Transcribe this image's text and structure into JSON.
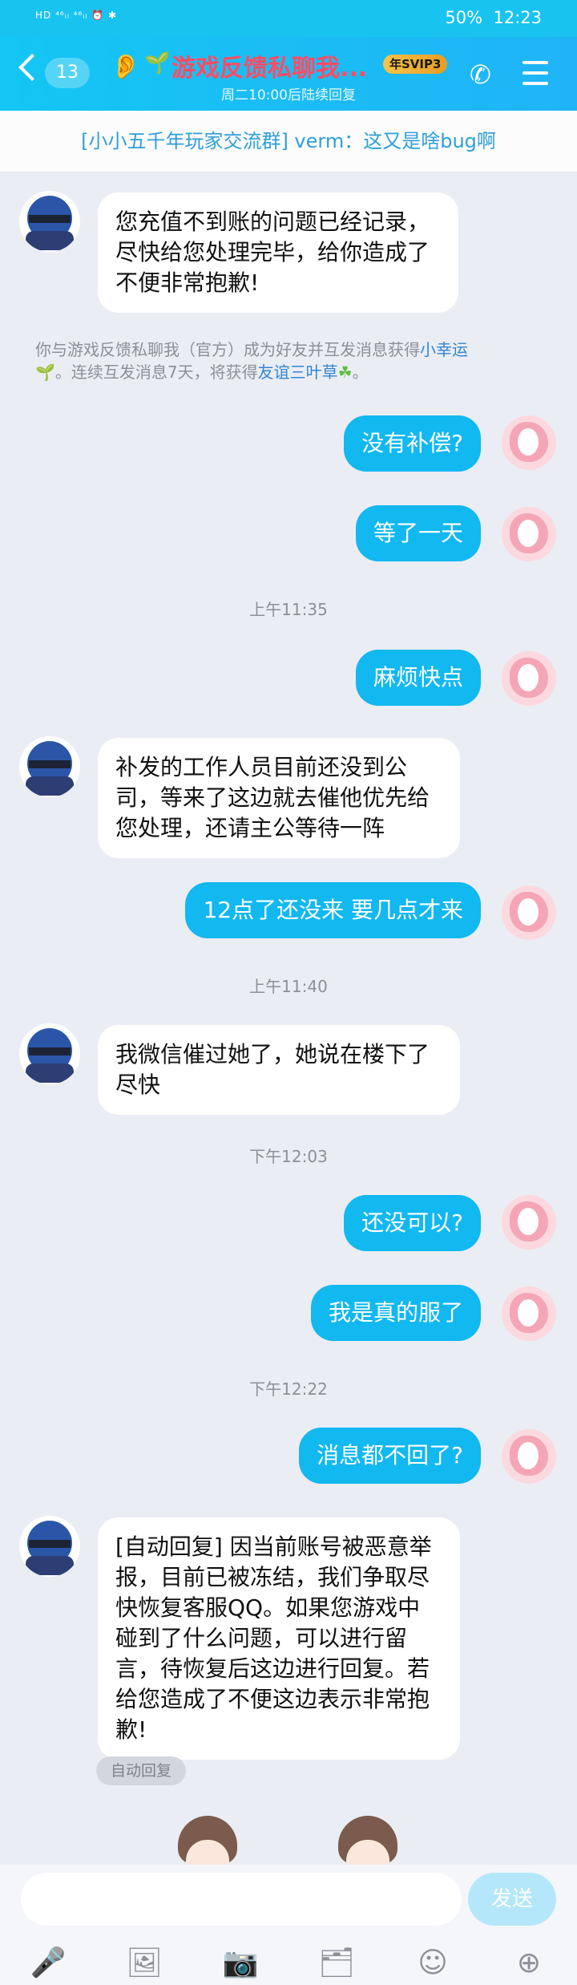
{
  "status": {
    "left": "HD ⁴⁶ᵢₗ ⁴⁶ᵢₗ ⏰ ✱",
    "battery": "50%",
    "time": "12:23"
  },
  "header": {
    "back_count": "13",
    "title": "游戏反馈私聊我...",
    "vip": "年SVIP3",
    "subtitle": "周二10:00后陆续回复"
  },
  "pinned": "[小小五千年玩家交流群] verm：这又是啥bug啊",
  "messages": {
    "m1": "您充值不到账的问题已经记录，尽快给您处理完毕，给你造成了不便非常抱歉!",
    "sys_a": "你与游戏反馈私聊我（官方）成为好友并互发消息获得",
    "sys_link1": "小幸运",
    "sys_b": "。连续互发消息7天，将获得",
    "sys_link2": "友谊三叶草",
    "m2": "没有补偿?",
    "m3": "等了一天",
    "t1": "上午11:35",
    "m4": "麻烦快点",
    "m5": "补发的工作人员目前还没到公司，等来了这边就去催他优先给您处理，还请主公等待一阵",
    "m6": "12点了还没来 要几点才来",
    "t2": "上午11:40",
    "m7": "我微信催过她了，她说在楼下了尽快",
    "t3": "下午12:03",
    "m8": "还没可以?",
    "m9": "我是真的服了",
    "t4": "下午12:22",
    "m10": "消息都不回了?",
    "m11": "[自动回复] 因当前账号被恶意举报，目前已被冻结，我们争取尽快恢复客服QQ。如果您游戏中碰到了什么问题，可以进行留言，待恢复后这边进行回复。若给您造成了不便这边表示非常抱歉!",
    "autotag": "自动回复"
  },
  "composer": {
    "send": "发送"
  },
  "icons": {
    "mic": "🎤",
    "image": "🖼",
    "camera": "📷",
    "file": "🗂",
    "emoji": "☺",
    "plus": "⊕"
  },
  "colors": {
    "header": "#18c3f0",
    "bubble_self": "#12b8f0",
    "title": "#ff4c63"
  }
}
